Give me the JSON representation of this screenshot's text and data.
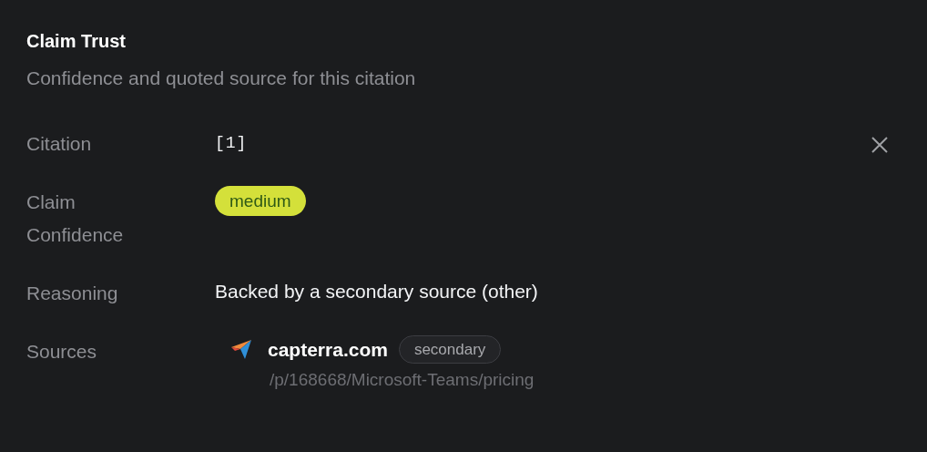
{
  "panel": {
    "title": "Claim Trust",
    "subtitle": "Confidence and quoted source for this citation"
  },
  "rows": [
    {
      "kind": "citation",
      "label": "Citation",
      "value": "[1]"
    },
    {
      "kind": "badge",
      "label": "Claim Confidence",
      "value": "medium"
    },
    {
      "kind": "text",
      "label": "Reasoning",
      "value": "Backed by a secondary source (other)"
    },
    {
      "kind": "sources",
      "label": "Sources",
      "sources": [
        {
          "domain": "capterra.com",
          "tag": "secondary",
          "path": "/p/168668/Microsoft-Teams/pricing"
        }
      ]
    }
  ]
}
